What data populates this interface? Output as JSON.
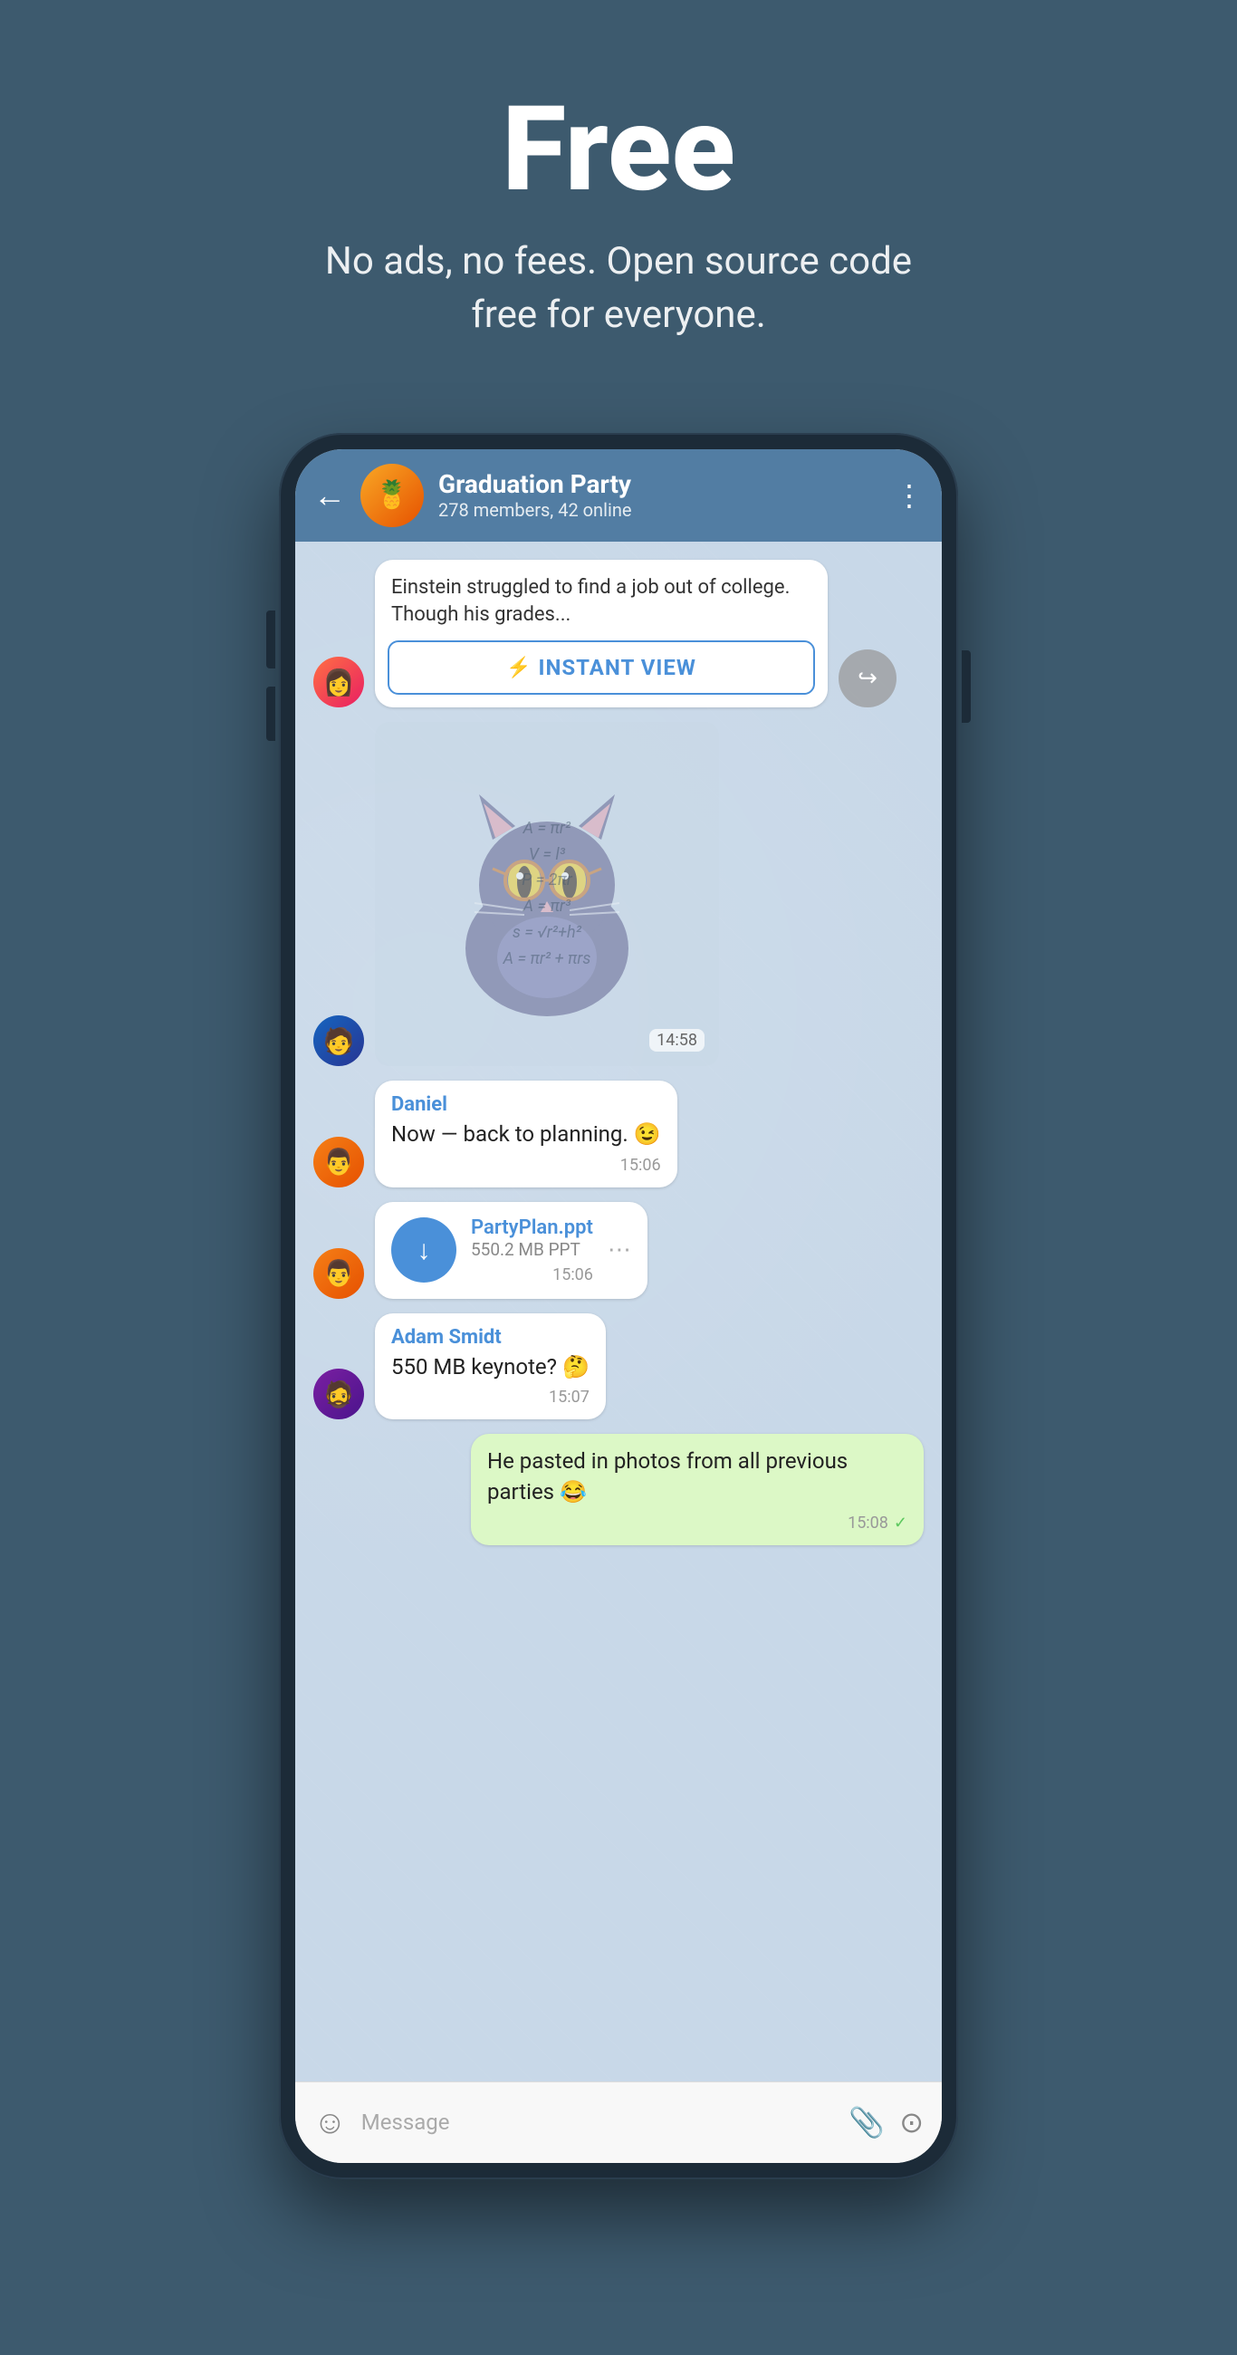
{
  "hero": {
    "title": "Free",
    "subtitle": "No ads, no fees. Open source code free for everyone."
  },
  "phone": {
    "header": {
      "back_label": "←",
      "group_name": "Graduation Party",
      "group_members": "278 members, 42 online",
      "more_icon": "⋮"
    },
    "messages": [
      {
        "id": "article-msg",
        "type": "article",
        "avatar": "female",
        "article_text": "Einstein struggled to find a job out of college. Though his grades...",
        "instant_view_label": "INSTANT VIEW"
      },
      {
        "id": "sticker-msg",
        "type": "sticker",
        "avatar": "male1",
        "time": "14:58"
      },
      {
        "id": "daniel-msg",
        "type": "text",
        "avatar": "male2",
        "sender": "Daniel",
        "text": "Now — back to planning. 😉",
        "time": "15:06"
      },
      {
        "id": "file-msg",
        "type": "file",
        "avatar": "male2",
        "file_name": "PartyPlan.ppt",
        "file_size": "550.2 MB PPT",
        "time": "15:06"
      },
      {
        "id": "adam-msg",
        "type": "text",
        "avatar": "male3",
        "sender": "Adam Smidt",
        "text": "550 MB keynote? 🤔",
        "time": "15:07"
      },
      {
        "id": "self-msg",
        "type": "text_self",
        "text": "He pasted in photos from all previous parties 😂",
        "time": "15:08",
        "check": "✓"
      }
    ],
    "input": {
      "placeholder": "Message",
      "emoji_icon": "☺",
      "attach_icon": "📎",
      "camera_icon": "⊙"
    }
  }
}
